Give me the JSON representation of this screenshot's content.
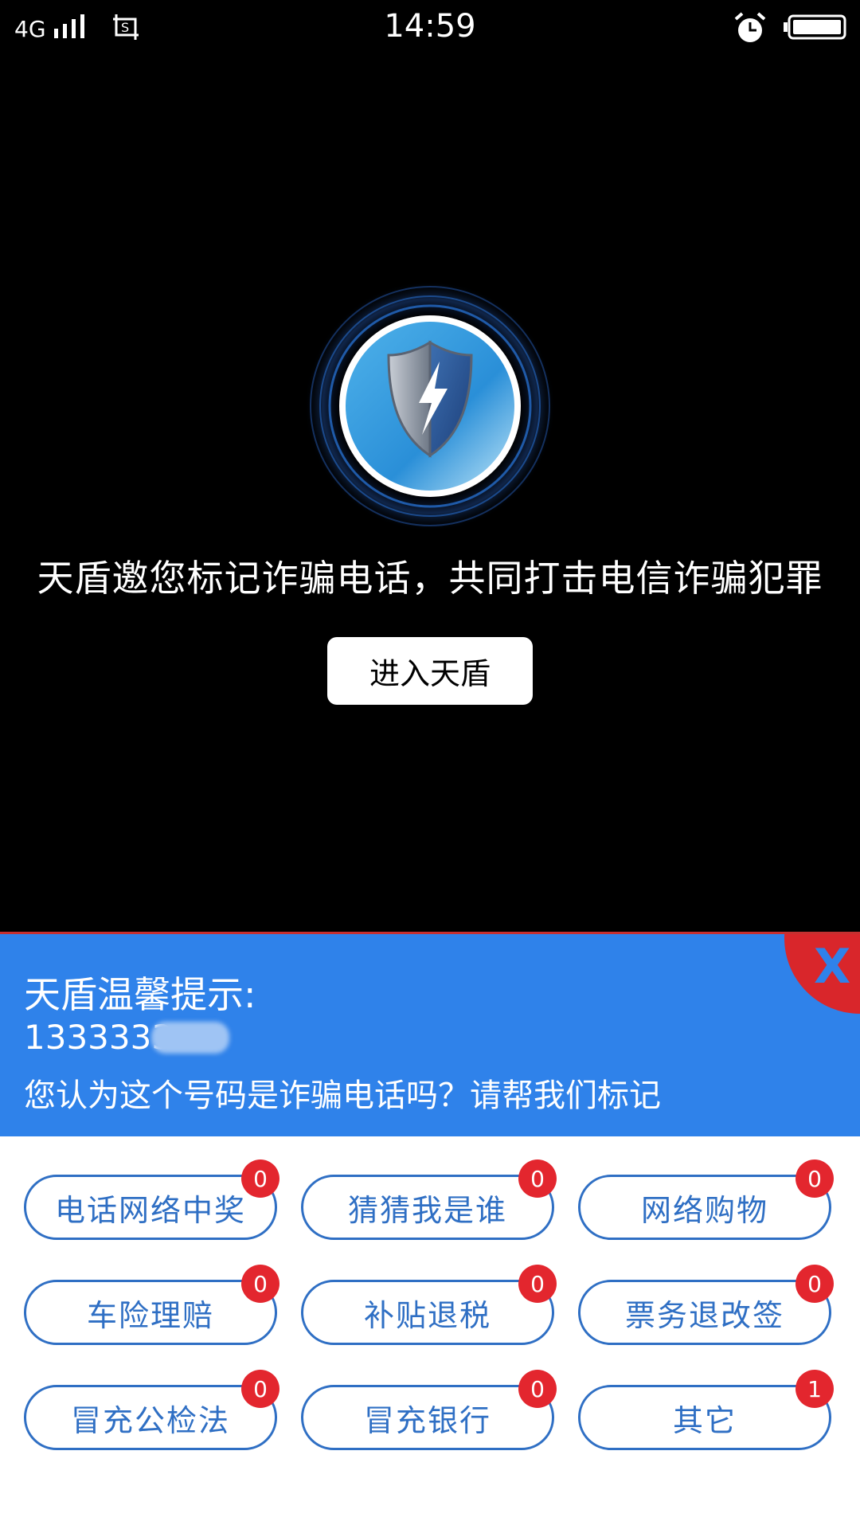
{
  "status_bar": {
    "network": "4G",
    "time": "14:59"
  },
  "hero": {
    "invite_text": "天盾邀您标记诈骗电话，共同打击电信诈骗犯罪",
    "enter_button": "进入天盾"
  },
  "tip": {
    "title": "天盾温馨提示:",
    "number_visible": "1333333",
    "question": "您认为这个号码是诈骗电话吗？请帮我们标记",
    "close_label": "X"
  },
  "options": [
    {
      "label": "电话网络中奖",
      "count": "0"
    },
    {
      "label": "猜猜我是谁",
      "count": "0"
    },
    {
      "label": "网络购物",
      "count": "0"
    },
    {
      "label": "车险理赔",
      "count": "0"
    },
    {
      "label": "补贴退税",
      "count": "0"
    },
    {
      "label": "票务退改签",
      "count": "0"
    },
    {
      "label": "冒充公检法",
      "count": "0"
    },
    {
      "label": "冒充银行",
      "count": "0"
    },
    {
      "label": "其它",
      "count": "1"
    }
  ],
  "colors": {
    "panel_blue": "#2f82ea",
    "option_border": "#2f6fc4",
    "badge_red": "#e3262e",
    "close_red": "#d9262b"
  },
  "icons": [
    "signal-icon",
    "screenshot-icon",
    "alarm-icon",
    "battery-icon",
    "shield-logo-icon"
  ]
}
